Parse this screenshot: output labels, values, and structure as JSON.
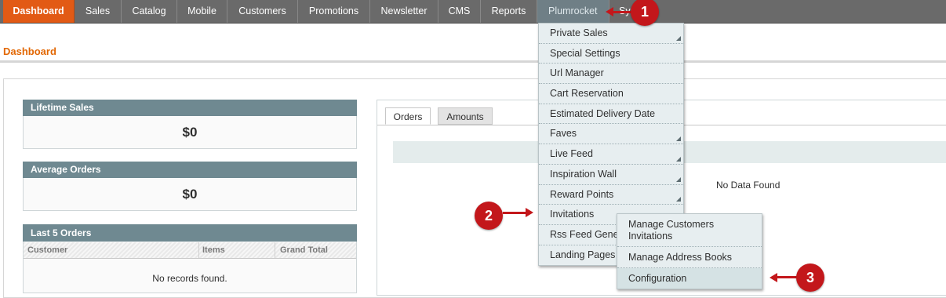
{
  "nav": {
    "items": [
      {
        "label": "Dashboard"
      },
      {
        "label": "Sales"
      },
      {
        "label": "Catalog"
      },
      {
        "label": "Mobile"
      },
      {
        "label": "Customers"
      },
      {
        "label": "Promotions"
      },
      {
        "label": "Newsletter"
      },
      {
        "label": "CMS"
      },
      {
        "label": "Reports"
      },
      {
        "label": "Plumrocket"
      },
      {
        "label": "Sys"
      }
    ],
    "active_color": "#e25a15"
  },
  "page": {
    "title": "Dashboard"
  },
  "lifetime_sales": {
    "label": "Lifetime Sales",
    "value": "$0"
  },
  "average_orders": {
    "label": "Average Orders",
    "value": "$0"
  },
  "last_orders": {
    "label": "Last 5 Orders",
    "columns": [
      "Customer",
      "Items",
      "Grand Total"
    ],
    "empty_text": "No records found."
  },
  "chart_tabs": {
    "tabs": [
      "Orders",
      "Amounts"
    ],
    "selected": "Orders",
    "empty_text": "No Data Found"
  },
  "plumrocket_menu": {
    "items": [
      {
        "label": "Private Sales",
        "has_submenu": true
      },
      {
        "label": "Special Settings",
        "has_submenu": false
      },
      {
        "label": "Url Manager",
        "has_submenu": false
      },
      {
        "label": "Cart Reservation",
        "has_submenu": false
      },
      {
        "label": "Estimated Delivery Date",
        "has_submenu": false
      },
      {
        "label": "Faves",
        "has_submenu": true
      },
      {
        "label": "Live Feed",
        "has_submenu": true
      },
      {
        "label": "Inspiration Wall",
        "has_submenu": true
      },
      {
        "label": "Reward Points",
        "has_submenu": true
      },
      {
        "label": "Invitations",
        "has_submenu": true
      },
      {
        "label": "Rss Feed Gene",
        "has_submenu": false
      },
      {
        "label": "Landing Pages",
        "has_submenu": false
      }
    ]
  },
  "invitations_submenu": {
    "items": [
      {
        "label": "Manage Customers Invitations"
      },
      {
        "label": "Manage Address Books"
      },
      {
        "label": "Configuration"
      }
    ]
  },
  "markers": [
    {
      "number": "1"
    },
    {
      "number": "2"
    },
    {
      "number": "3"
    }
  ],
  "marker_color": "#c3171b"
}
